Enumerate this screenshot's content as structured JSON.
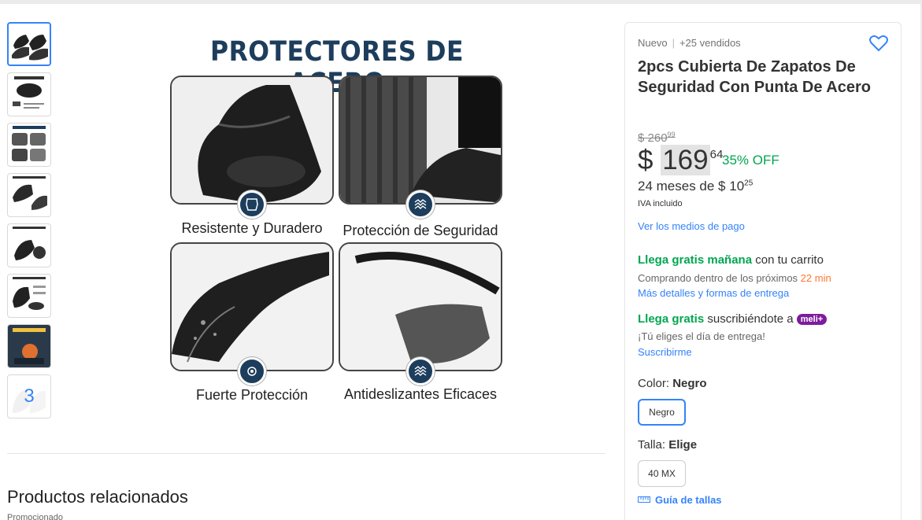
{
  "gallery": {
    "more_count": "3",
    "image": {
      "title": "PROTECTORES DE ACERO",
      "captions": [
        "Resistente y Duradero",
        "Protección de Seguridad",
        "Fuerte Protección",
        "Antideslizantes Eficaces"
      ]
    }
  },
  "related": {
    "title": "Productos relacionados",
    "subtitle": "Promocionado"
  },
  "product": {
    "condition": "Nuevo",
    "sold": "+25 vendidos",
    "title": "2pcs Cubierta De Zapatos De Seguridad Con Punta De Acero",
    "old_price": "$ 260",
    "old_price_cents": "99",
    "currency": "$",
    "price": "169",
    "price_cents": "64",
    "discount": "35% OFF",
    "installments": "24 meses de $ 10",
    "installments_cents": "25",
    "tax": "IVA incluido",
    "payment_link": "Ver los medios de pago"
  },
  "shipping": {
    "free_tomorrow": "Llega gratis mañana",
    "with_cart": " con tu carrito",
    "buying_within": "Comprando dentro de los próximos ",
    "countdown": "22 min",
    "details_link": "Más detalles y formas de entrega",
    "free": "Llega gratis",
    "subscribing": " suscribiéndote a ",
    "meli_badge": "meli+",
    "choose_day": "¡Tú eliges el día de entrega!",
    "subscribe_link": "Suscribirme"
  },
  "variants": {
    "color_label": "Color: ",
    "color_value": "Negro",
    "color_option": "Negro",
    "size_label": "Talla: ",
    "size_value": "Elige",
    "size_option": "40 MX",
    "size_guide": "Guía de tallas"
  },
  "colors": {
    "accent": "#3483fa",
    "green": "#00a650",
    "orange": "#ff7733",
    "meli": "#7e1c9d",
    "navy": "#1d3d5c"
  }
}
